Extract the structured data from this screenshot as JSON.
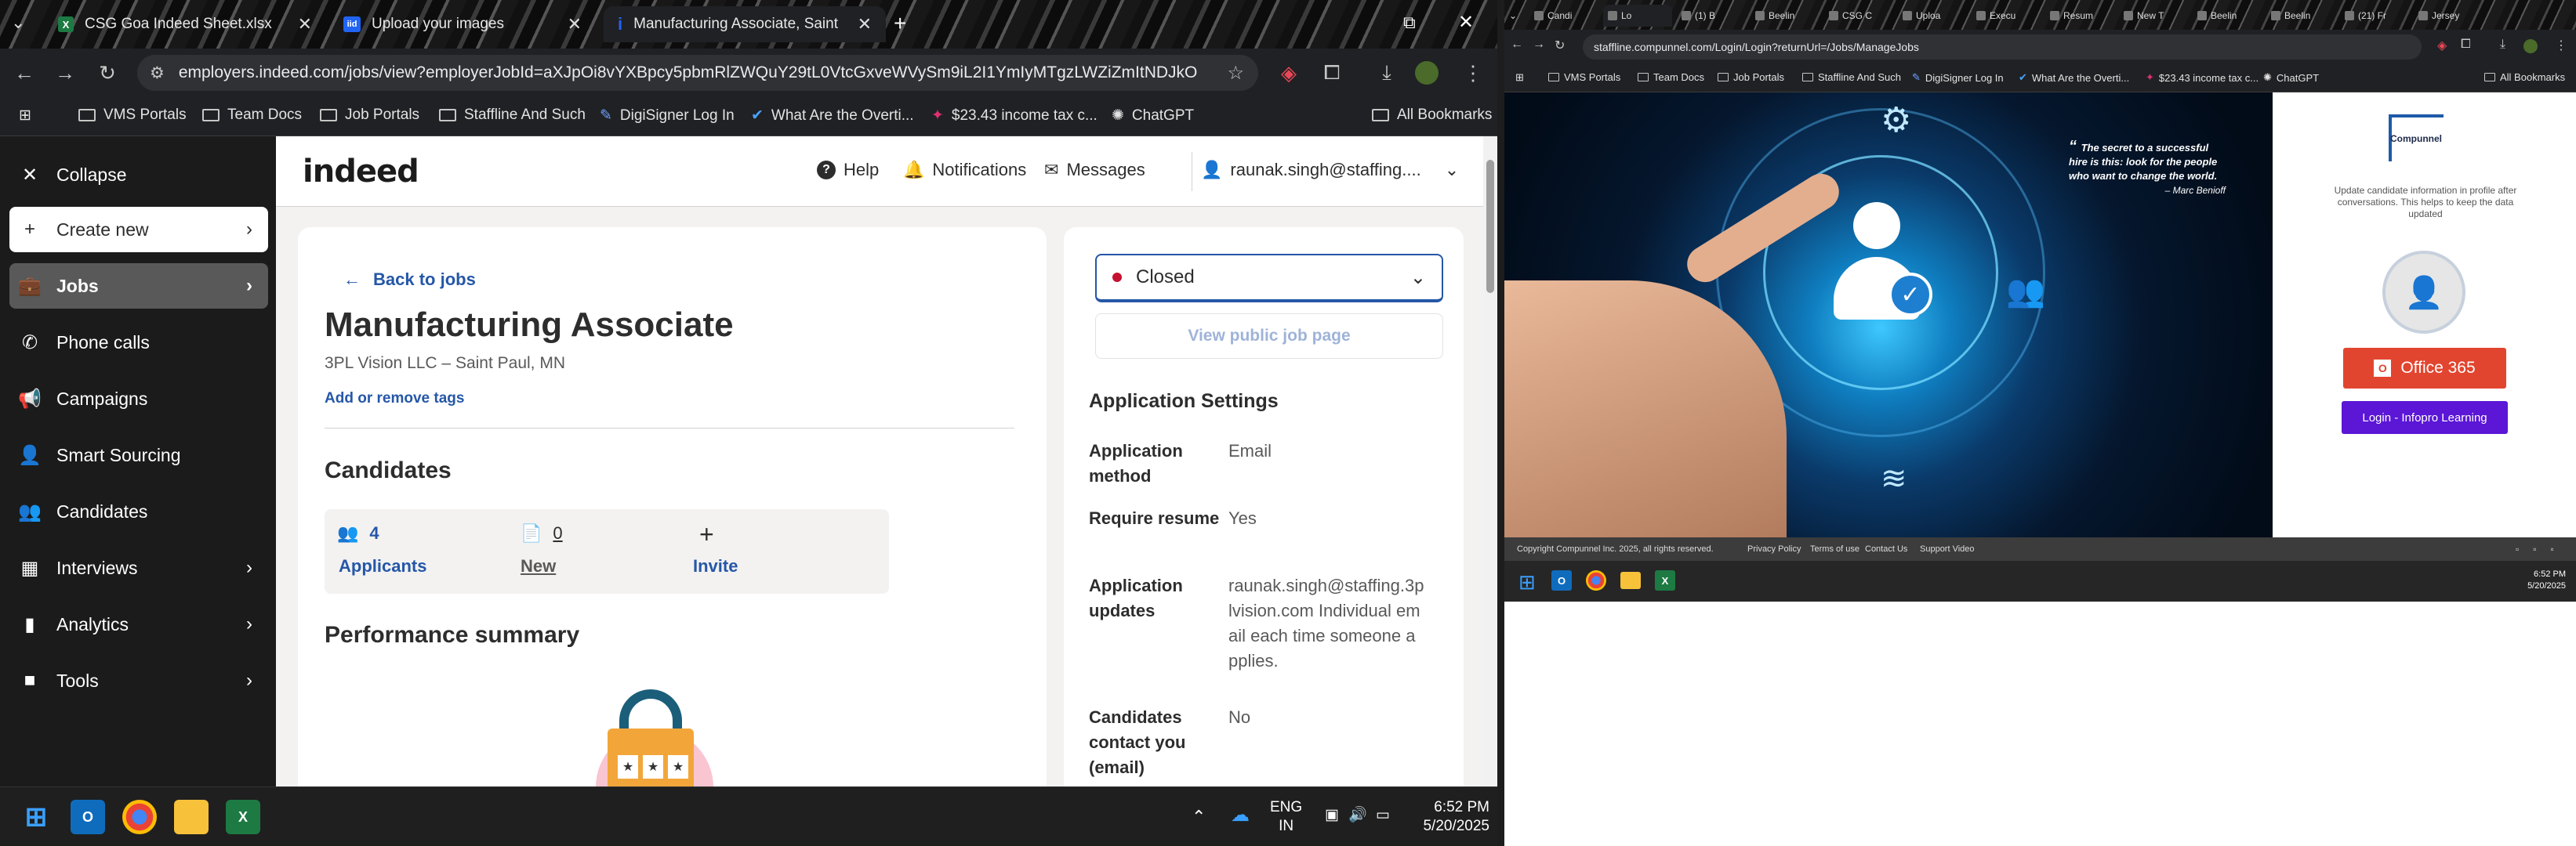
{
  "left_browser": {
    "tabs": [
      {
        "title": "CSG Goa Indeed Sheet.xlsx",
        "favicon": "excel-icon"
      },
      {
        "title": "Upload your images",
        "favicon": "indeed-icon"
      },
      {
        "title": "Manufacturing Associate, Saint",
        "favicon": "indeed-icon"
      }
    ],
    "url": "employers.indeed.com/jobs/view?employerJobId=aXJpOi8vYXBpcy5pbmRlZWQuY29tL0VtcGxveWVySm9iL2I1YmIyMTgzLWZiZmItNDJkOC0...",
    "bookmarks": [
      "VMS Portals",
      "Team Docs",
      "Job Portals",
      "Staffline And Such",
      "DigiSigner Log In",
      "What Are the Overti...",
      "$23.43 income tax c...",
      "ChatGPT"
    ],
    "all_bookmarks": "All Bookmarks"
  },
  "sidebar": {
    "collapse": "Collapse",
    "create_new": "Create new",
    "items": [
      {
        "label": "Jobs",
        "icon": "briefcase-icon",
        "has_chevron": true
      },
      {
        "label": "Phone calls",
        "icon": "phone-icon",
        "has_chevron": false
      },
      {
        "label": "Campaigns",
        "icon": "megaphone-icon",
        "has_chevron": false
      },
      {
        "label": "Smart Sourcing",
        "icon": "person-search-icon",
        "has_chevron": false
      },
      {
        "label": "Candidates",
        "icon": "people-icon",
        "has_chevron": false
      },
      {
        "label": "Interviews",
        "icon": "calendar-icon",
        "has_chevron": true
      },
      {
        "label": "Analytics",
        "icon": "bar-chart-icon",
        "has_chevron": true
      },
      {
        "label": "Tools",
        "icon": "folder-icon",
        "has_chevron": true
      }
    ]
  },
  "header": {
    "logo": "indeed",
    "help": "Help",
    "notifications": "Notifications",
    "messages": "Messages",
    "account": "raunak.singh@staffing...."
  },
  "job": {
    "back": "Back to jobs",
    "title": "Manufacturing Associate",
    "company": "3PL Vision LLC – Saint Paul, MN",
    "tags": "Add or remove tags",
    "candidates_heading": "Candidates",
    "applicants_count": "4",
    "applicants_label": "Applicants",
    "new_count": "0",
    "new_label": "New",
    "invite_label": "Invite",
    "performance_heading": "Performance summary"
  },
  "status": {
    "value": "Closed",
    "view_public": "View public job page",
    "settings_heading": "Application Settings",
    "settings": [
      {
        "label": "Application method",
        "value": "Email"
      },
      {
        "label": "Require resume",
        "value": "Yes"
      },
      {
        "label": "Application updates",
        "value": "raunak.singh@staffing.3plvision.com Individual email each time someone applies."
      },
      {
        "label": "Candidates contact you (email)",
        "value": "No"
      }
    ]
  },
  "taskbar": {
    "lang1": "ENG",
    "lang2": "IN",
    "time": "6:52 PM",
    "date": "5/20/2025"
  },
  "right_browser": {
    "tabs": [
      "Candi",
      "Lo",
      "(1) B",
      "Beelin",
      "CSG C",
      "Uploa",
      "Execu",
      "Resum",
      "New T",
      "Beelin",
      "Beelin",
      "(21) Fr",
      "Jersey"
    ],
    "url": "staffline.compunnel.com/Login/Login?returnUrl=/Jobs/ManageJobs",
    "bookmarks": [
      "VMS Portals",
      "Team Docs",
      "Job Portals",
      "Staffline And Such",
      "DigiSigner Log In",
      "What Are the Overti...",
      "$23.43 income tax c...",
      "ChatGPT"
    ],
    "all_bookmarks": "All Bookmarks"
  },
  "compunnel": {
    "quote": "The secret to a successful hire is this: look for the people who want to change the world.",
    "quote_author": "– Marc Benioff",
    "logo_text": "Compunnel",
    "update_text": "Update candidate information in profile after conversations. This helps to keep the data updated",
    "office_button": "Office 365",
    "inforpro_button": "Login - Infopro Learning",
    "footer_copyright": "Copyright Compunnel Inc. 2025, all rights reserved.",
    "footer_links": [
      "Privacy Policy",
      "Terms of use",
      "Contact Us",
      "Support Video"
    ],
    "time": "6:52 PM",
    "date": "5/20/2025",
    "office_color": "#e2452f",
    "inforpro_color": "#5b16d6"
  }
}
